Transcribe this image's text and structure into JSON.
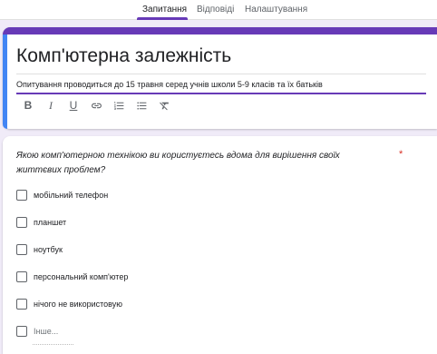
{
  "tabs": [
    {
      "label": "Запитання",
      "active": true
    },
    {
      "label": "Відповіді",
      "active": false
    },
    {
      "label": "Налаштування",
      "active": false
    }
  ],
  "form": {
    "title": "Комп'ютерна залежність",
    "description": "Опитування проводиться до 15 травня серед учнів школи 5-9 класів та їх батьків"
  },
  "toolbar": {
    "icons": [
      "bold-icon",
      "italic-icon",
      "underline-icon",
      "link-icon",
      "numbered-list-icon",
      "bulleted-list-icon",
      "clear-formatting-icon"
    ],
    "bold": "B",
    "italic": "I",
    "underline": "U"
  },
  "question": {
    "text": "Якою комп'ютерною технікою ви користуєтесь вдома для вирішення своїх життєвих проблем?",
    "required_mark": "*",
    "options": [
      "мобільний телефон",
      "планшет",
      "ноутбук",
      "персональний комп'ютер",
      "нічого не використовую"
    ],
    "other_label": "Інше..."
  },
  "colors": {
    "accent": "#673ab7",
    "focus_bar": "#4285f4",
    "background": "#f0ebf8",
    "required": "#d93025"
  }
}
